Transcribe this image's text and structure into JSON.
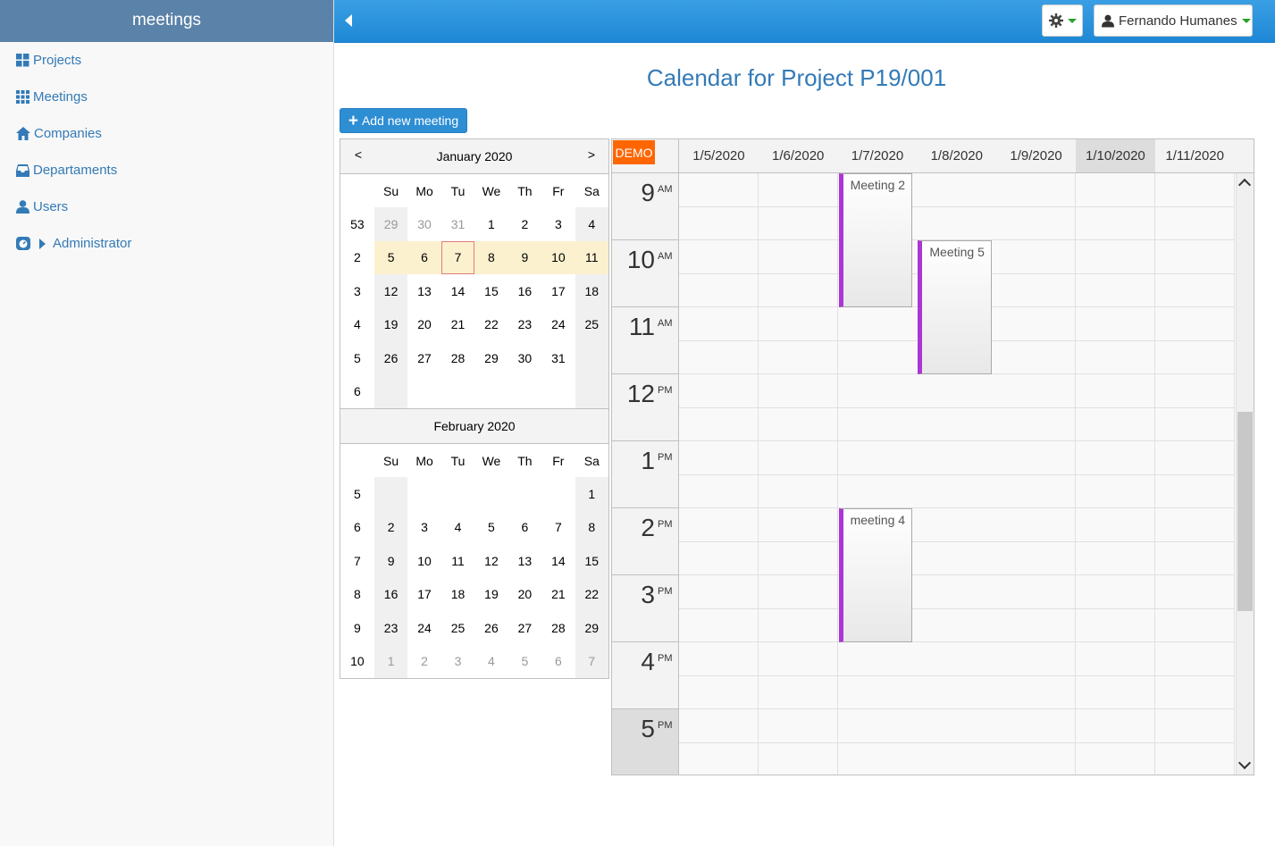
{
  "app": {
    "name": "meetings"
  },
  "sidebar": {
    "items": [
      {
        "label": "Projects",
        "icon": "grid-icon"
      },
      {
        "label": "Meetings",
        "icon": "table-icon"
      },
      {
        "label": "Companies",
        "icon": "home-icon"
      },
      {
        "label": "Departaments",
        "icon": "inbox-icon"
      },
      {
        "label": "Users",
        "icon": "user-icon"
      },
      {
        "label": "Administrator",
        "icon": "gauge-icon"
      }
    ]
  },
  "topbar": {
    "settings_icon": "gear-icon",
    "user_name": "Fernando Humanes"
  },
  "page": {
    "title": "Calendar for Project P19/001",
    "add_button": "Add new meeting"
  },
  "navigator": {
    "prev": "<",
    "next": ">",
    "dow": [
      "Su",
      "Mo",
      "Tu",
      "We",
      "Th",
      "Fr",
      "Sa"
    ],
    "months": [
      {
        "title": "January 2020",
        "weeks": [
          {
            "wk": "53",
            "days": [
              "29",
              "30",
              "31",
              "1",
              "2",
              "3",
              "4"
            ],
            "other": [
              0,
              1,
              2
            ]
          },
          {
            "wk": "2",
            "days": [
              "5",
              "6",
              "7",
              "8",
              "9",
              "10",
              "11"
            ],
            "selected": true,
            "today": 2
          },
          {
            "wk": "3",
            "days": [
              "12",
              "13",
              "14",
              "15",
              "16",
              "17",
              "18"
            ]
          },
          {
            "wk": "4",
            "days": [
              "19",
              "20",
              "21",
              "22",
              "23",
              "24",
              "25"
            ]
          },
          {
            "wk": "5",
            "days": [
              "26",
              "27",
              "28",
              "29",
              "30",
              "31",
              ""
            ]
          },
          {
            "wk": "6",
            "days": [
              "",
              "",
              "",
              "",
              "",
              "",
              ""
            ]
          }
        ]
      },
      {
        "title": "February 2020",
        "weeks": [
          {
            "wk": "5",
            "days": [
              "",
              "",
              "",
              "",
              "",
              "",
              "1"
            ]
          },
          {
            "wk": "6",
            "days": [
              "2",
              "3",
              "4",
              "5",
              "6",
              "7",
              "8"
            ]
          },
          {
            "wk": "7",
            "days": [
              "9",
              "10",
              "11",
              "12",
              "13",
              "14",
              "15"
            ]
          },
          {
            "wk": "8",
            "days": [
              "16",
              "17",
              "18",
              "19",
              "20",
              "21",
              "22"
            ]
          },
          {
            "wk": "9",
            "days": [
              "23",
              "24",
              "25",
              "26",
              "27",
              "28",
              "29"
            ]
          },
          {
            "wk": "10",
            "days": [
              "1",
              "2",
              "3",
              "4",
              "5",
              "6",
              "7"
            ],
            "other": [
              0,
              1,
              2,
              3,
              4,
              5,
              6
            ]
          }
        ]
      }
    ]
  },
  "calendar": {
    "badge": "DEMO",
    "days": [
      "1/5/2020",
      "1/6/2020",
      "1/7/2020",
      "1/8/2020",
      "1/9/2020",
      "1/10/2020",
      "1/11/2020"
    ],
    "highlight_day": 5,
    "hours": [
      {
        "num": "9",
        "ap": "AM"
      },
      {
        "num": "10",
        "ap": "AM"
      },
      {
        "num": "11",
        "ap": "AM"
      },
      {
        "num": "12",
        "ap": "PM"
      },
      {
        "num": "1",
        "ap": "PM"
      },
      {
        "num": "2",
        "ap": "PM"
      },
      {
        "num": "3",
        "ap": "PM"
      },
      {
        "num": "4",
        "ap": "PM"
      },
      {
        "num": "5",
        "ap": "PM"
      }
    ],
    "highlight_hour": 8,
    "events": [
      {
        "title": "Meeting 2",
        "day": 2,
        "start": "9:00 AM",
        "end": "11:00 AM"
      },
      {
        "title": "Meeting 5",
        "day": 3,
        "start": "10:00 AM",
        "end": "12:00 PM"
      },
      {
        "title": "meeting 4",
        "day": 2,
        "start": "2:00 PM",
        "end": "4:00 PM"
      }
    ],
    "event_color": "#aa37d4"
  }
}
